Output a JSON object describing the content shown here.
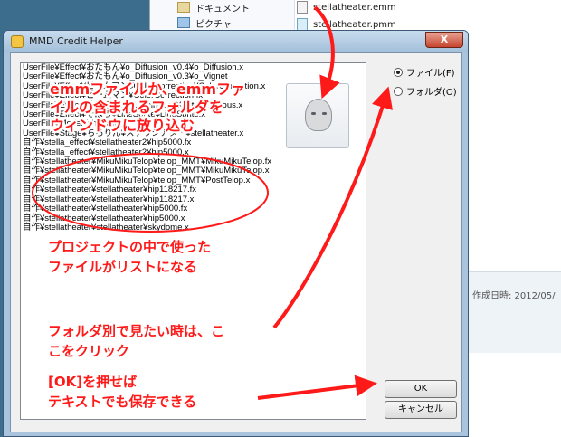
{
  "explorer": {
    "nav_items": [
      {
        "label": "ドキュメント",
        "icon": "document-folder-icon"
      },
      {
        "label": "ピクチャ",
        "icon": "picture-folder-icon"
      }
    ],
    "files": [
      {
        "label": "stellatheater.emm",
        "icon": "emm-file-icon"
      },
      {
        "label": "stellatheater.pmm",
        "icon": "pmm-file-icon"
      }
    ],
    "created_date": "作成日時: 2012/05/"
  },
  "dialog": {
    "title": "MMD Credit Helper",
    "close_label": "X",
    "list_items": [
      "UserFile¥Effect¥おたもん¥o_Diffusion_v0.4¥o_Diffusion.x",
      "UserFile¥Effect¥おたもん¥o_Diffusion_v0.3¥o_Vignet",
      "UserFile¥Effect¥ビームマン¥ColorCorrection¥ColorCorrection.x",
      "UserFile¥Effect¥ビームマン¥ColorCorrection.fx",
      "UserFile¥Effect¥そぼろ¥AutoLuminous4¥AutoLuminous.x",
      "UserFile¥Effect¥そぼろ¥LineSprite¥LineSprite.x",
      "UserFile¥Model¥shadow.x",
      "UserFile¥Stage¥ちろりん¥ステラシアター¥stellatheater.x",
      "自作¥stella_effect¥stellatheater2¥hip5000.fx",
      "自作¥stella_effect¥stellatheater2¥hip5000.x",
      "自作¥stellatheater¥MikuMikuTelop¥telop_MMT¥MikuMikuTelop.fx",
      "自作¥stellatheater¥MikuMikuTelop¥telop_MMT¥MikuMikuTelop.x",
      "自作¥stellatheater¥MikuMikuTelop¥telop_MMT¥PostTelop.x",
      "自作¥stellatheater¥stellatheater¥hip118217.fx",
      "自作¥stellatheater¥stellatheater¥hip118217.x",
      "自作¥stellatheater¥stellatheater¥hip5000.fx",
      "自作¥stellatheater¥stellatheater¥hip5000.x",
      "自作¥stellatheater¥stellatheater¥skydome.x"
    ],
    "radio_file": "ファイル(F)",
    "radio_folder": "フォルダ(O)",
    "selected_mode": "file",
    "ok_label": "OK",
    "cancel_label": "キャンセル"
  },
  "annotations": {
    "drop_hint": [
      "emmファイルか、emmファ",
      "イルの含まれるフォルダを",
      "ウィンドウに放り込む"
    ],
    "list_hint": [
      "プロジェクトの中で使った",
      "ファイルがリストになる"
    ],
    "folder_hint": [
      "フォルダ別で見たい時は、こ",
      "こをクリック"
    ],
    "ok_hint": [
      "[OK]を押せば",
      "テキストでも保存できる"
    ],
    "color": "#ff1a1a"
  }
}
